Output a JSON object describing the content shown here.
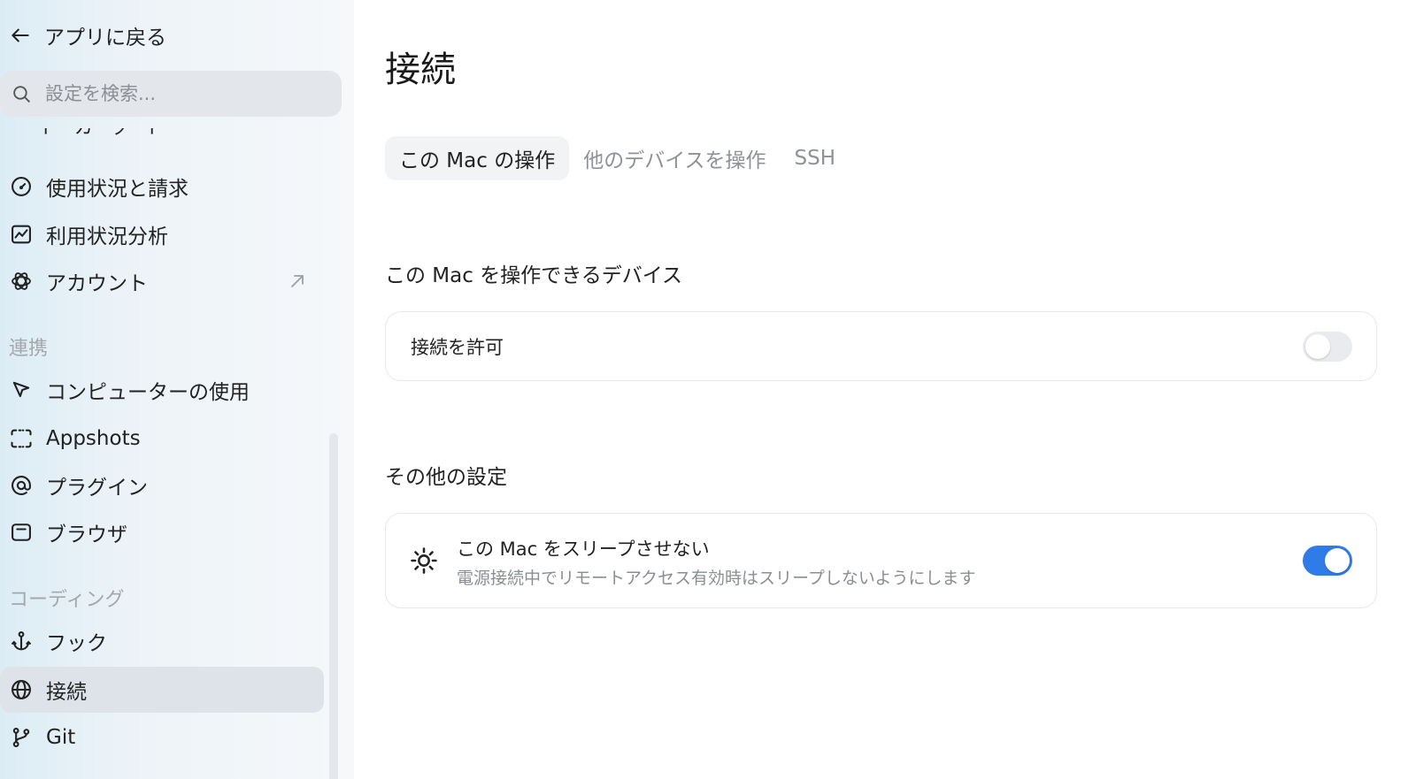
{
  "sidebar": {
    "back_label": "アプリに戻る",
    "search_placeholder": "設定を検索...",
    "clipped_item_label": "キーボードショートカット",
    "items_top": [
      {
        "label": "使用状況と請求",
        "icon": "gauge-icon"
      },
      {
        "label": "利用状況分析",
        "icon": "chart-icon"
      },
      {
        "label": "アカウント",
        "icon": "openai-icon",
        "external": true
      }
    ],
    "section_integrations": "連携",
    "items_integrations": [
      {
        "label": "コンピューターの使用",
        "icon": "cursor-icon"
      },
      {
        "label": "Appshots",
        "icon": "screenshot-icon"
      },
      {
        "label": "プラグイン",
        "icon": "at-icon"
      },
      {
        "label": "ブラウザ",
        "icon": "browser-icon"
      }
    ],
    "section_coding": "コーディング",
    "items_coding": [
      {
        "label": "フック",
        "icon": "anchor-icon"
      },
      {
        "label": "接続",
        "icon": "globe-icon",
        "active": true
      },
      {
        "label": "Git",
        "icon": "git-branch-icon"
      }
    ]
  },
  "main": {
    "title": "接続",
    "tabs": [
      {
        "label": "この Mac の操作",
        "active": true
      },
      {
        "label": "他のデバイスを操作",
        "active": false
      },
      {
        "label": "SSH",
        "active": false
      }
    ],
    "section1_heading": "この Mac を操作できるデバイス",
    "allow_connection": {
      "label": "接続を許可",
      "enabled": false
    },
    "section2_heading": "その他の設定",
    "keep_awake": {
      "title": "この Mac をスリープさせない",
      "description": "電源接続中でリモートアクセス有効時はスリープしないようにします",
      "enabled": true
    }
  },
  "colors": {
    "accent": "#2f7ce8",
    "active_item_bg": "#dde3e9",
    "muted_text": "#8a8e93"
  }
}
